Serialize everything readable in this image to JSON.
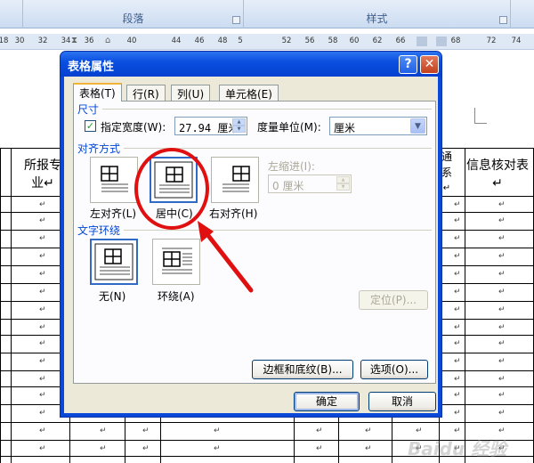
{
  "ribbon": {
    "groups": [
      "段落",
      "样式"
    ]
  },
  "ruler": {
    "ticks": [
      "18",
      "30",
      "32",
      "34",
      "36",
      "38",
      "40",
      "44",
      "46",
      "48",
      "5",
      "52",
      "56",
      "58",
      "60",
      "62",
      "66",
      "68",
      "72",
      "74"
    ]
  },
  "document": {
    "header_cells": [
      "所报专业↵",
      "信息核对表↵"
    ],
    "partial_cells": [
      "通",
      "系",
      "↵"
    ],
    "cell_mark": "↵"
  },
  "dialog": {
    "title": "表格属性",
    "help_glyph": "?",
    "close_glyph": "✕",
    "tabs": [
      "表格(T)",
      "行(R)",
      "列(U)",
      "单元格(E)"
    ],
    "size_group": {
      "label": "尺寸",
      "pref_width_checked": true,
      "pref_width_label": "指定宽度(W):",
      "pref_width_value": "27.94 厘米",
      "measure_label": "度量单位(M):",
      "measure_value": "厘米"
    },
    "align_group": {
      "label": "对齐方式",
      "options": [
        "左对齐(L)",
        "居中(C)",
        "右对齐(H)"
      ],
      "selected": "居中(C)",
      "indent_label": "左缩进(I):",
      "indent_value": "0 厘米"
    },
    "wrap_group": {
      "label": "文字环绕",
      "options": [
        "无(N)",
        "环绕(A)"
      ],
      "selected": "无(N)"
    },
    "buttons": {
      "positioning": "定位(P)...",
      "borders": "边框和底纹(B)...",
      "options": "选项(O)...",
      "ok": "确定",
      "cancel": "取消"
    }
  },
  "watermark": "Baidu 经验",
  "colors": {
    "title_bar": "#0a4fe0",
    "group_label": "#0046d5",
    "annotation": "#e01010"
  }
}
